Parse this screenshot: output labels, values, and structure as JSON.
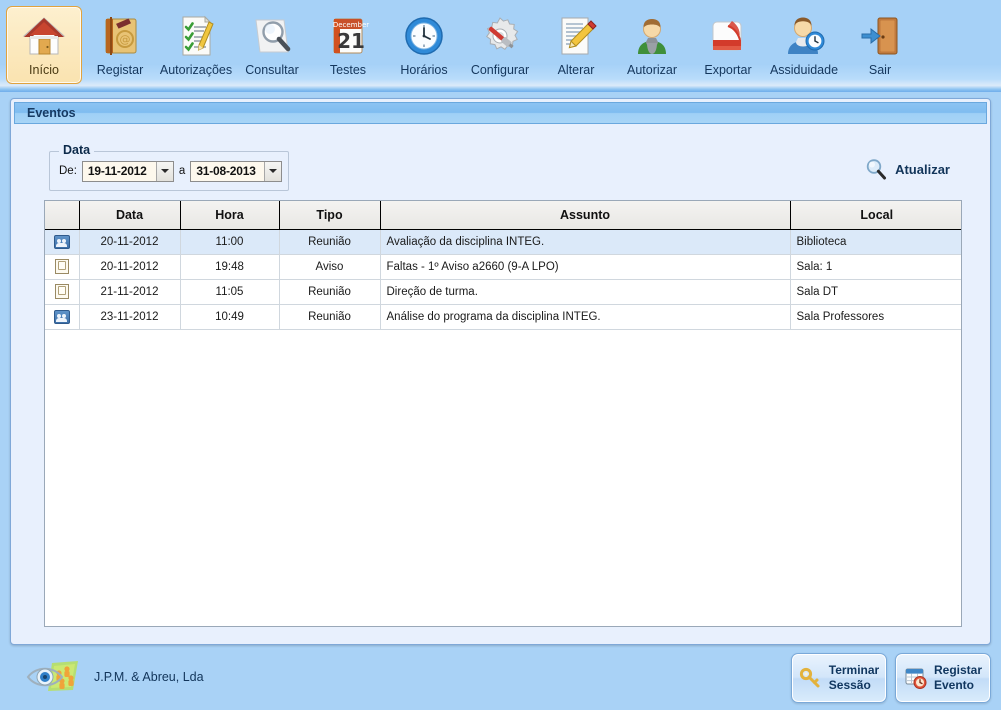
{
  "app": {
    "background_color": "#a9d2f6",
    "panel_color": "#e8f0fd",
    "accent_color": "#12355a",
    "selected_row_color": "#dbe9f9"
  },
  "toolbar": {
    "items": [
      {
        "label": "Início",
        "icon": "house-icon",
        "selected": true
      },
      {
        "label": "Registar",
        "icon": "address-book-icon",
        "selected": false
      },
      {
        "label": "Autorizações",
        "icon": "checklist-icon",
        "selected": false
      },
      {
        "label": "Consultar",
        "icon": "magnifier-icon",
        "selected": false
      },
      {
        "label": "Testes",
        "icon": "calendar-icon",
        "selected": false
      },
      {
        "label": "Horários",
        "icon": "clock-icon",
        "selected": false
      },
      {
        "label": "Configurar",
        "icon": "gear-tool-icon",
        "selected": false
      },
      {
        "label": "Alterar",
        "icon": "document-pencil-icon",
        "selected": false
      },
      {
        "label": "Autorizar",
        "icon": "person-green-icon",
        "selected": false
      },
      {
        "label": "Exportar",
        "icon": "pdf-export-icon",
        "selected": false
      },
      {
        "label": "Assiduidade",
        "icon": "person-clock-icon",
        "selected": false
      },
      {
        "label": "Sair",
        "icon": "exit-door-icon",
        "selected": false
      }
    ]
  },
  "panel": {
    "title": "Eventos"
  },
  "filter": {
    "legend": "Data",
    "from_label": "De:",
    "from_value": "19-11-2012",
    "between_label": "a",
    "to_value": "31-08-2013"
  },
  "refresh": {
    "label": "Atualizar",
    "icon": "magnifier-icon"
  },
  "table": {
    "columns": [
      "",
      "Data",
      "Hora",
      "Tipo",
      "Assunto",
      "Local"
    ],
    "rows": [
      {
        "icon": "meeting-icon",
        "data": "20-11-2012",
        "hora": "11:00",
        "tipo": "Reunião",
        "assunto": "Avaliação da disciplina INTEG.",
        "local": "Biblioteca",
        "selected": true
      },
      {
        "icon": "note-icon",
        "data": "20-11-2012",
        "hora": "19:48",
        "tipo": "Aviso",
        "assunto": "Faltas - 1º Aviso a2660 (9-A LPO)",
        "local": "Sala: 1",
        "selected": false
      },
      {
        "icon": "note-icon",
        "data": "21-11-2012",
        "hora": "11:05",
        "tipo": "Reunião",
        "assunto": "Direção de turma.",
        "local": "Sala DT",
        "selected": false
      },
      {
        "icon": "meeting-icon",
        "data": "23-11-2012",
        "hora": "10:49",
        "tipo": "Reunião",
        "assunto": "Análise do programa da disciplina INTEG.",
        "local": "Sala Professores",
        "selected": false
      }
    ]
  },
  "footer": {
    "brand_text": "J.P.M. & Abreu, Lda",
    "brand_icon": "company-logo-icon",
    "buttons": [
      {
        "label": "Terminar\nSessão",
        "icon": "key-icon"
      },
      {
        "label": "Registar\nEvento",
        "icon": "calendar-clock-icon"
      }
    ]
  }
}
